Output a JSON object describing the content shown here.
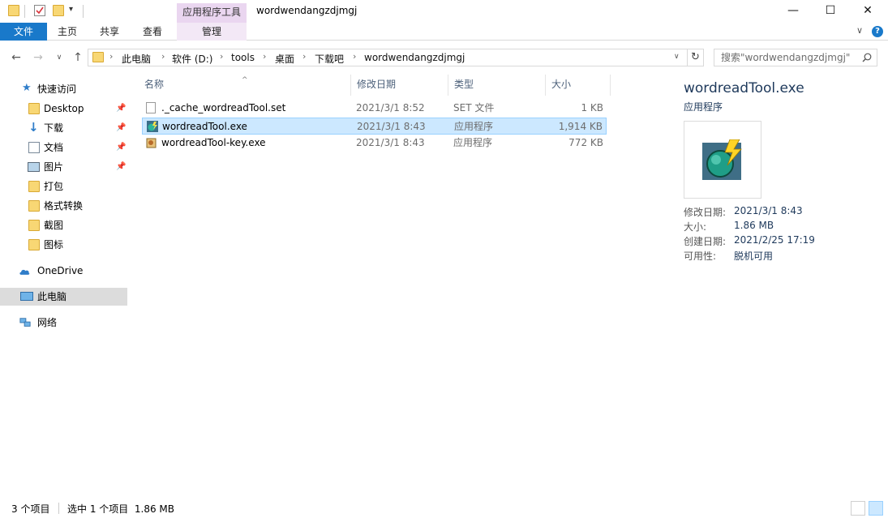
{
  "titlebar": {
    "tools_tab": "应用程序工具",
    "window_title": "wordwendangzdjmgj",
    "minimize": "—",
    "maximize": "☐",
    "close": "✕"
  },
  "ribbon": {
    "tabs": [
      "文件",
      "主页",
      "共享",
      "查看",
      "管理"
    ],
    "collapse": "∨",
    "help": "?"
  },
  "address": {
    "crumbs": [
      "此电脑",
      "软件 (D:)",
      "tools",
      "桌面",
      "下载吧",
      "wordwendangzdjmgj"
    ],
    "search_placeholder": "搜索\"wordwendangzdjmgj\""
  },
  "sidebar": {
    "items": [
      {
        "label": "快速访问",
        "icon": "star-icon"
      },
      {
        "label": "Desktop",
        "icon": "folder-icon",
        "pinned": true
      },
      {
        "label": "下载",
        "icon": "download-icon",
        "pinned": true
      },
      {
        "label": "文档",
        "icon": "document-icon",
        "pinned": true
      },
      {
        "label": "图片",
        "icon": "pictures-icon",
        "pinned": true
      },
      {
        "label": "打包",
        "icon": "folder-icon"
      },
      {
        "label": "格式转换",
        "icon": "folder-icon"
      },
      {
        "label": "截图",
        "icon": "folder-icon"
      },
      {
        "label": "图标",
        "icon": "folder-icon"
      },
      {
        "label": "OneDrive",
        "icon": "cloud-icon"
      },
      {
        "label": "此电脑",
        "icon": "computer-icon",
        "selected": true
      },
      {
        "label": "网络",
        "icon": "network-icon"
      }
    ]
  },
  "filelist": {
    "columns": [
      "名称",
      "修改日期",
      "类型",
      "大小"
    ],
    "rows": [
      {
        "name": "._cache_wordreadTool.set",
        "date": "2021/3/1 8:52",
        "type": "SET 文件",
        "size": "1 KB"
      },
      {
        "name": "wordreadTool.exe",
        "date": "2021/3/1 8:43",
        "type": "应用程序",
        "size": "1,914 KB",
        "selected": true
      },
      {
        "name": "wordreadTool-key.exe",
        "date": "2021/3/1 8:43",
        "type": "应用程序",
        "size": "772 KB"
      }
    ]
  },
  "details": {
    "name": "wordreadTool.exe",
    "type": "应用程序",
    "props": [
      {
        "key": "修改日期:",
        "value": "2021/3/1 8:43"
      },
      {
        "key": "大小:",
        "value": "1.86 MB"
      },
      {
        "key": "创建日期:",
        "value": "2021/2/25 17:19"
      },
      {
        "key": "可用性:",
        "value": "脱机可用"
      }
    ]
  },
  "status": {
    "item_count": "3 个项目",
    "selection": "选中 1 个项目  1.86 MB"
  },
  "colors": {
    "accent": "#1979ca",
    "selection": "#cce8ff",
    "tools_tab": "#ead6f0"
  }
}
